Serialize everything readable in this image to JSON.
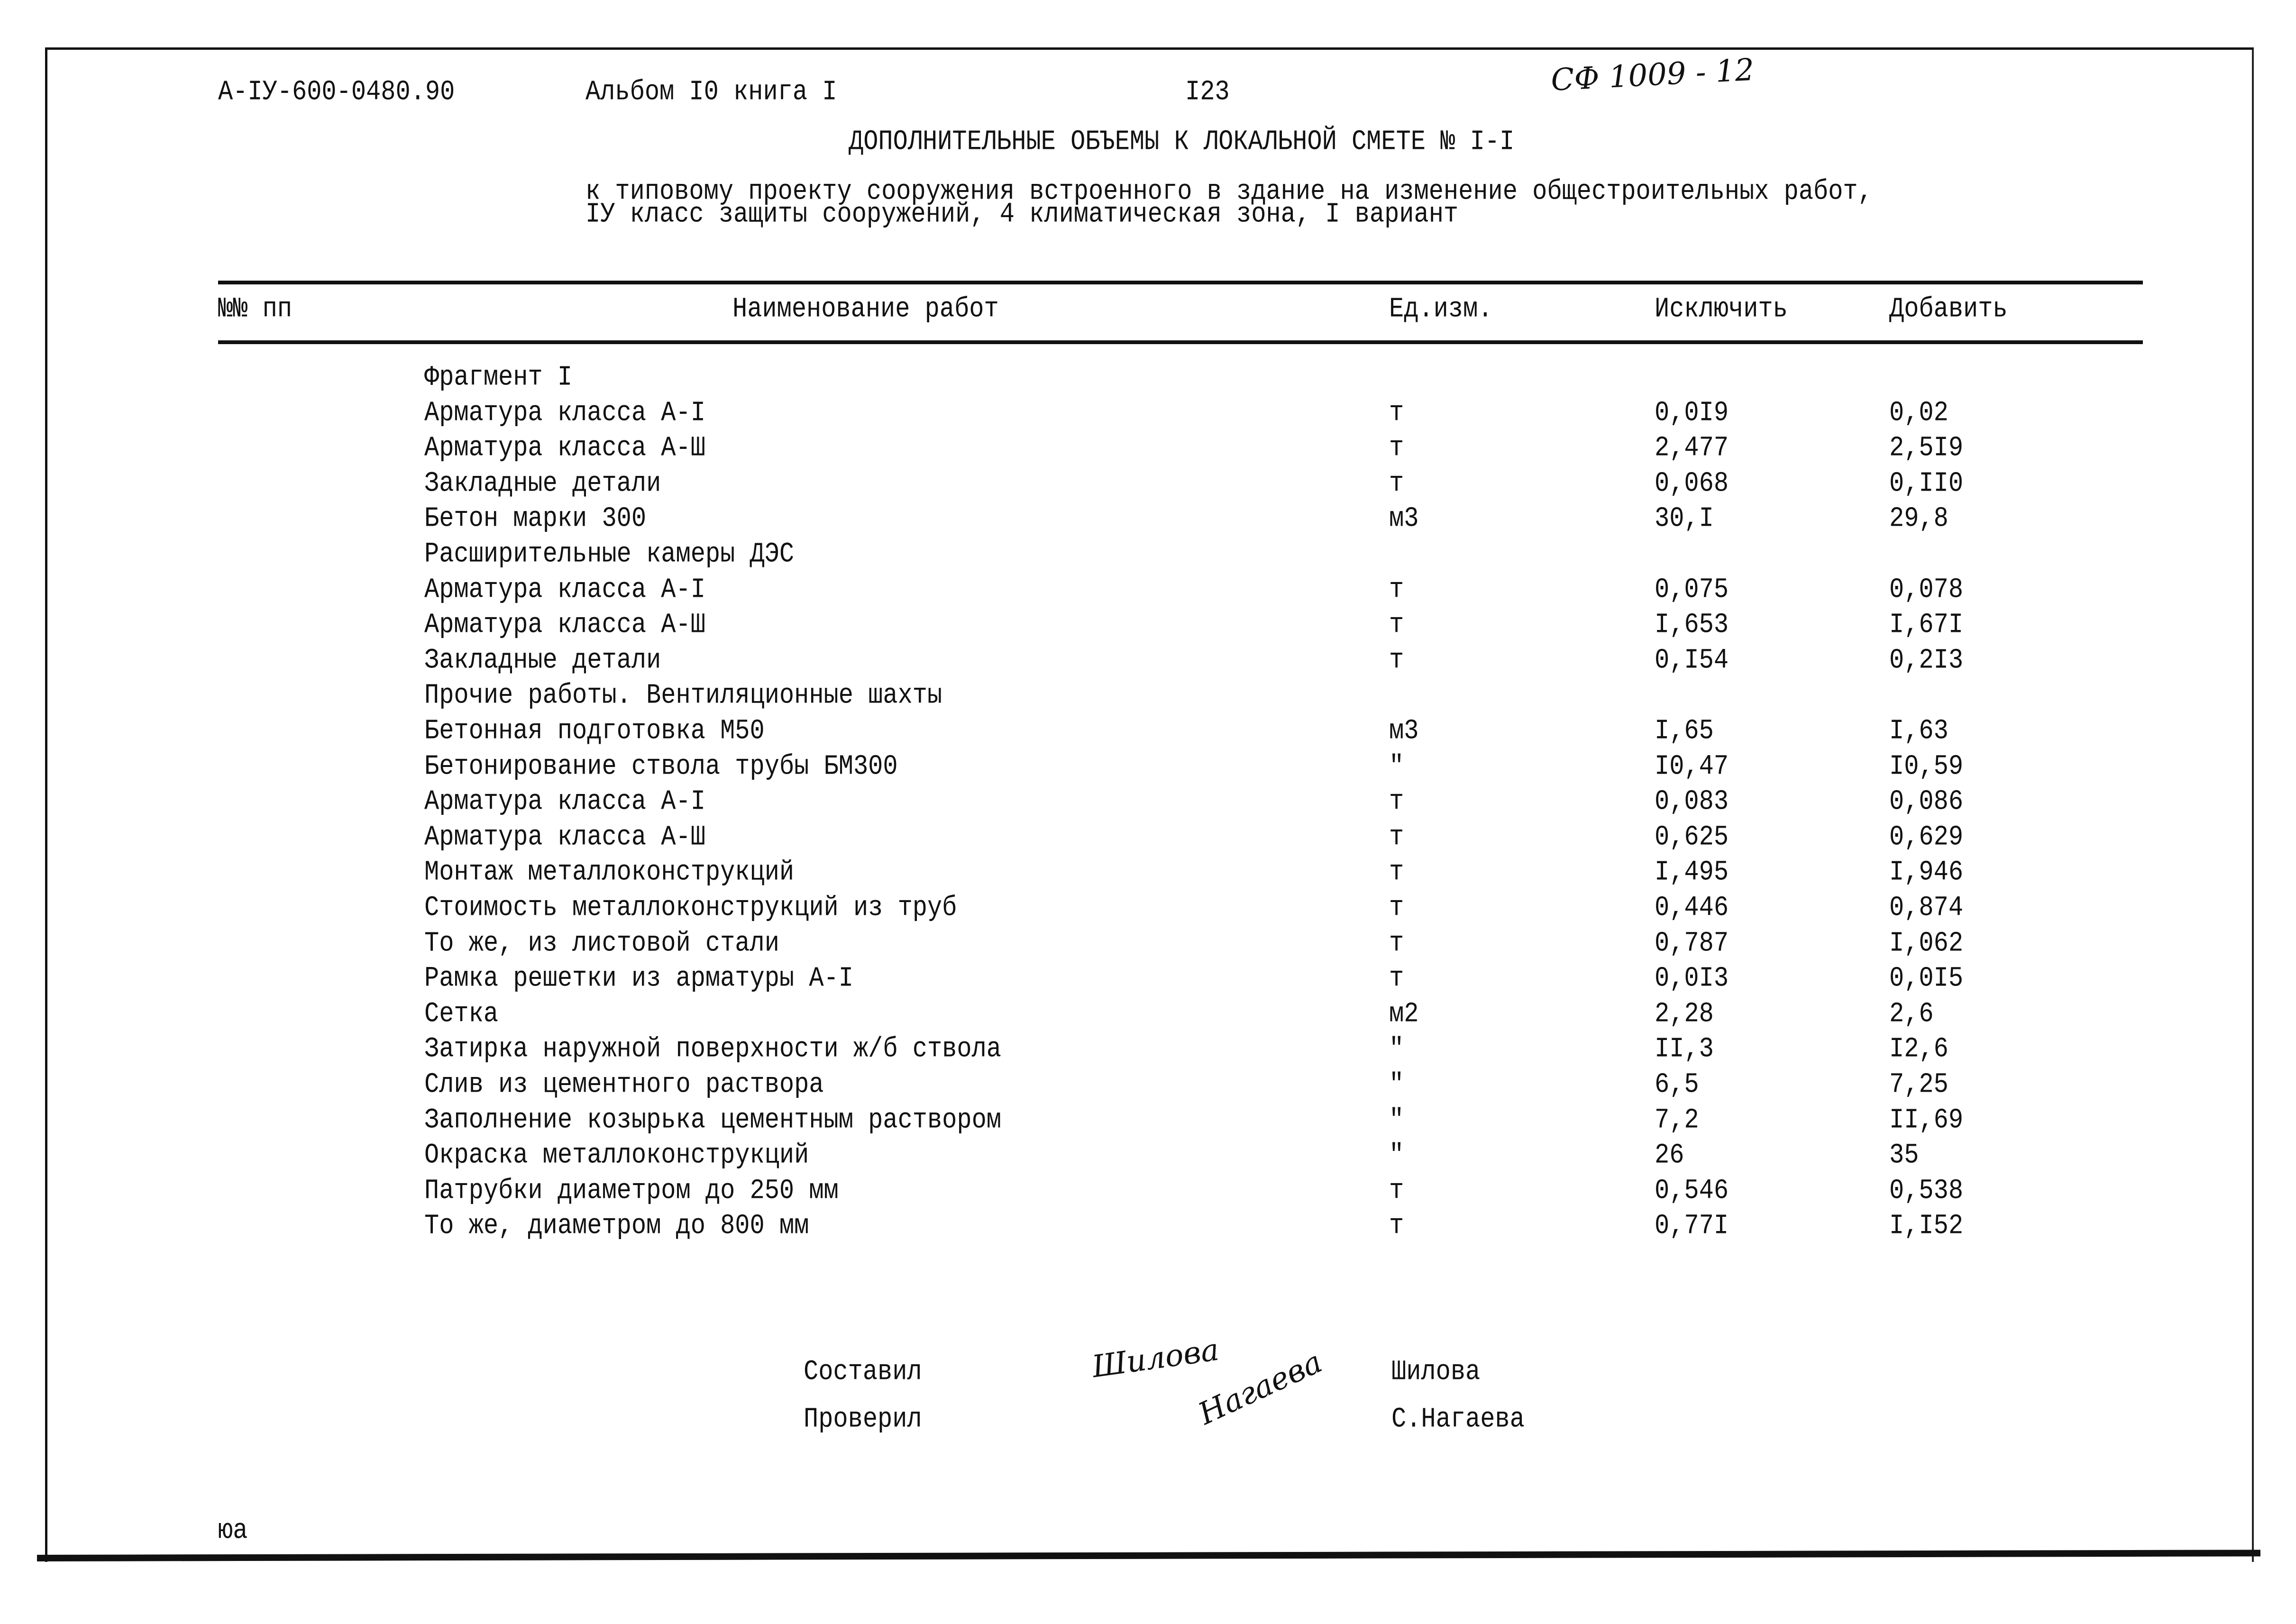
{
  "header": {
    "doc_code": "А-IУ-600-0480.90",
    "album": "Альбом I0 книга I",
    "page_number": "I23",
    "handwritten_code": "СФ 1009 - 12"
  },
  "title": "ДОПОЛНИТЕЛЬНЫЕ ОБЪЕМЫ К ЛОКАЛЬНОЙ СМЕТЕ № I-I",
  "subtitle": {
    "line1": "к типовому проекту сооружения встроенного в здание на изменение общестроительных работ,",
    "line2": "IУ класс защиты сооружений, 4 климатическая зона, I вариант"
  },
  "table": {
    "columns": {
      "num": "№№ пп",
      "name": "Наименование работ",
      "unit": "Ед.изм.",
      "exclude": "Исключить",
      "add": "Добавить"
    },
    "rows": [
      {
        "name": "Фрагмент I",
        "unit": "",
        "exclude": "",
        "add": "",
        "section": true
      },
      {
        "name": "Арматура класса А-I",
        "unit": "т",
        "exclude": "0,0I9",
        "add": "0,02"
      },
      {
        "name": "Арматура класса А-Ш",
        "unit": "т",
        "exclude": "2,477",
        "add": "2,5I9"
      },
      {
        "name": "Закладные детали",
        "unit": "т",
        "exclude": "0,068",
        "add": "0,II0"
      },
      {
        "name": "Бетон марки 300",
        "unit": "м3",
        "exclude": "30,I",
        "add": "29,8"
      },
      {
        "name": "Расширительные камеры ДЭС",
        "unit": "",
        "exclude": "",
        "add": "",
        "section": true
      },
      {
        "name": "Арматура класса А-I",
        "unit": "т",
        "exclude": "0,075",
        "add": "0,078"
      },
      {
        "name": "Арматура класса А-Ш",
        "unit": "т",
        "exclude": "I,653",
        "add": "I,67I"
      },
      {
        "name": "Закладные детали",
        "unit": "т",
        "exclude": "0,I54",
        "add": "0,2I3"
      },
      {
        "name": "Прочие работы. Вентиляционные шахты",
        "unit": "",
        "exclude": "",
        "add": "",
        "section": true
      },
      {
        "name": "Бетонная подготовка М50",
        "unit": "м3",
        "exclude": "I,65",
        "add": "I,63"
      },
      {
        "name": "Бетонирование ствола трубы БМ300",
        "unit": "\"",
        "exclude": "I0,47",
        "add": "I0,59"
      },
      {
        "name": "Арматура класса А-I",
        "unit": "т",
        "exclude": "0,083",
        "add": "0,086"
      },
      {
        "name": "Арматура класса А-Ш",
        "unit": "т",
        "exclude": "0,625",
        "add": "0,629"
      },
      {
        "name": "Монтаж металлоконструкций",
        "unit": "т",
        "exclude": "I,495",
        "add": "I,946"
      },
      {
        "name": "Стоимость металлоконструкций из труб",
        "unit": "т",
        "exclude": "0,446",
        "add": "0,874"
      },
      {
        "name": "То же, из листовой стали",
        "unit": "т",
        "exclude": "0,787",
        "add": "I,062"
      },
      {
        "name": "Рамка решетки из арматуры А-I",
        "unit": "т",
        "exclude": "0,0I3",
        "add": "0,0I5"
      },
      {
        "name": "Сетка",
        "unit": "м2",
        "exclude": "2,28",
        "add": "2,6"
      },
      {
        "name": "Затирка наружной поверхности ж/б ствола",
        "unit": "\"",
        "exclude": "II,3",
        "add": "I2,6"
      },
      {
        "name": "Слив из цементного раствора",
        "unit": "\"",
        "exclude": "6,5",
        "add": "7,25"
      },
      {
        "name": "Заполнение козырька цементным раствором",
        "unit": "\"",
        "exclude": "7,2",
        "add": "II,69"
      },
      {
        "name": "Окраска металлоконструкций",
        "unit": "\"",
        "exclude": "26",
        "add": "35"
      },
      {
        "name": "Патрубки диаметром до 250 мм",
        "unit": "т",
        "exclude": "0,546",
        "add": "0,538"
      },
      {
        "name": "То же, диаметром до 800 мм",
        "unit": "т",
        "exclude": "0,77I",
        "add": "I,I52"
      }
    ]
  },
  "signatures": {
    "compiled_label": "Составил",
    "compiled_signature": "Шилова",
    "compiled_name": "Шилова",
    "checked_label": "Проверил",
    "checked_signature": "Нагаева",
    "checked_name": "С.Нагаева"
  },
  "footer_mark": "юа"
}
